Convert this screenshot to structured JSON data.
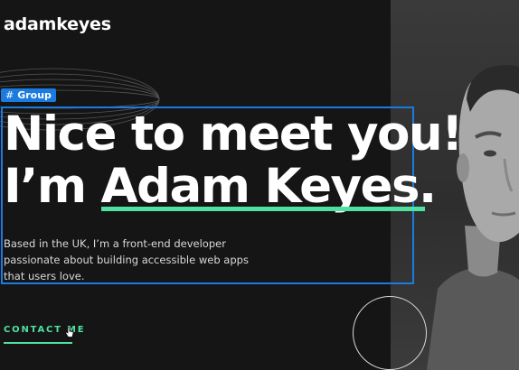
{
  "header": {
    "logo": "adamkeyes"
  },
  "editor": {
    "selection_badge": "Group",
    "badge_icon": "hash-icon",
    "selection_color": "#1a7be0"
  },
  "hero": {
    "headline_line1": "Nice to meet you!",
    "headline_prefix": "I’m ",
    "headline_name": "Adam Keyes.",
    "intro": "Based in the UK, I’m a front-end developer passionate about building accessible web apps that users love.",
    "cta_label": "CONTACT ME",
    "accent_color": "#4ee1a0"
  }
}
